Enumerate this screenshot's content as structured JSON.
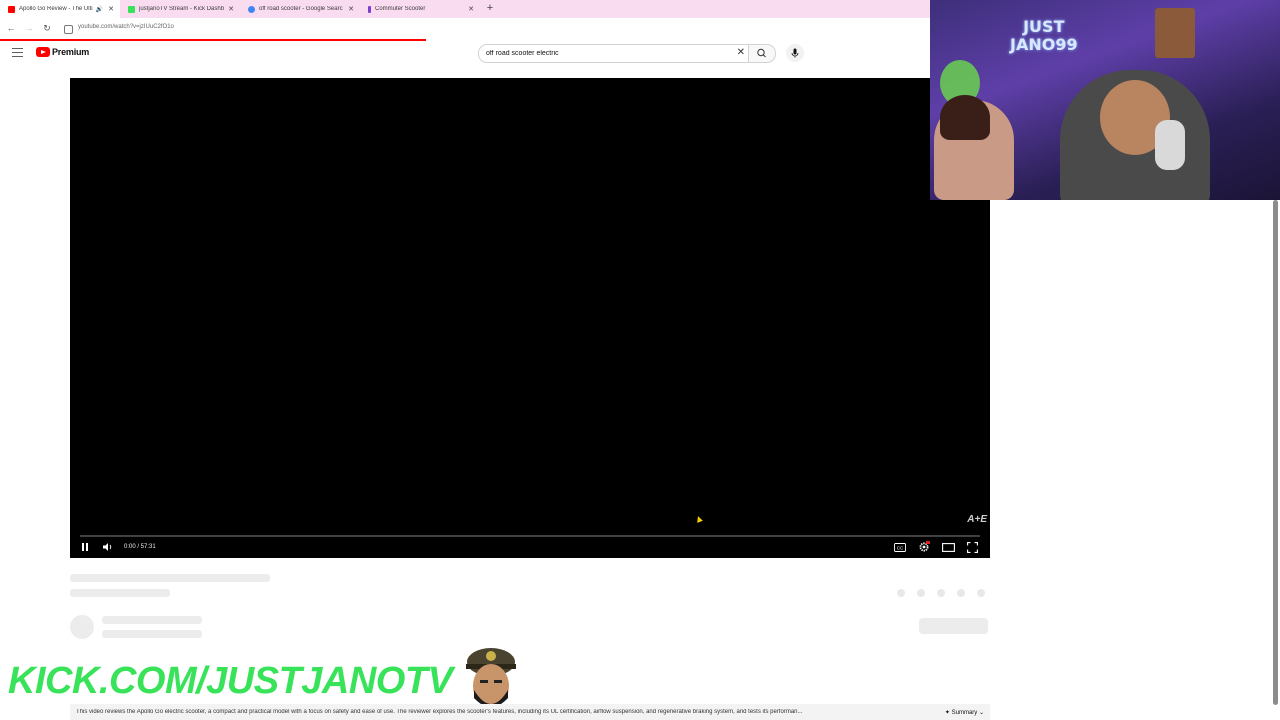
{
  "browser": {
    "tabs": [
      {
        "title": "Apollo Go Review - The Ulti",
        "active": true,
        "audio": true,
        "favicon_color": "#ff0000"
      },
      {
        "title": "justjanoTV Stream - Kick Dashb",
        "active": false,
        "audio": false,
        "favicon_color": "#38e35a"
      },
      {
        "title": "off road scooter - Google Searc",
        "active": false,
        "audio": false,
        "favicon_color": "#4285f4"
      },
      {
        "title": "Commuter Scooter",
        "active": false,
        "audio": false,
        "favicon_color": "#7a3fd0"
      }
    ],
    "url": "youtube.com/watch?v=jzIUuC2fO1o"
  },
  "youtube": {
    "logo_text": "Premium",
    "search_query": "off road scooter electric"
  },
  "player": {
    "timecode": "0:00 / 57:31",
    "progress_fraction": 0.0,
    "watermark": "A+E"
  },
  "overlays": {
    "webcam_text_line1": "JUST",
    "webcam_text_line2": "JANO99",
    "kick_banner": "KICK.COM/JUSTJANOTV"
  },
  "summary": {
    "text": "This video reviews the Apollo Go electric scooter, a compact and practical model with a focus on safety and ease of use. The reviewer explores the scooter's features, including its UL certification, airflow suspension, and regenerative braking system, and tests its performan...",
    "button_label": "Summary"
  },
  "colors": {
    "tabstrip": "#f9dcf0",
    "yt_red": "#ff0000",
    "kick_green": "#38e35a"
  }
}
